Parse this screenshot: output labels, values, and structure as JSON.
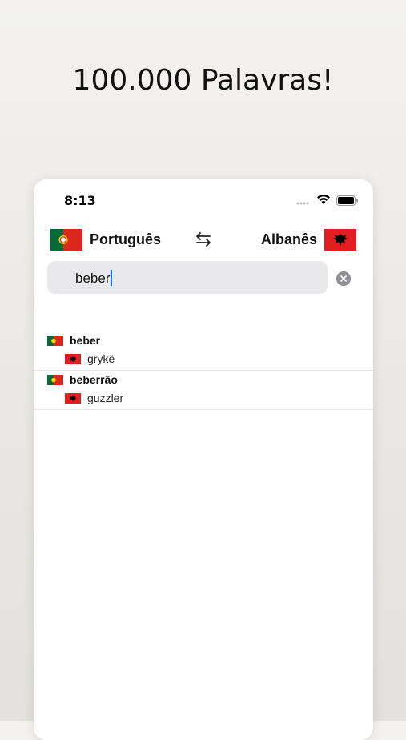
{
  "headline": "100.000 Palavras!",
  "status": {
    "time": "8:13"
  },
  "languages": {
    "source": "Português",
    "target": "Albanês",
    "source_flag": "portugal-flag",
    "target_flag": "albania-flag"
  },
  "search": {
    "value": "beber"
  },
  "results": [
    {
      "word": "beber",
      "translation": "grykë"
    },
    {
      "word": "beberrão",
      "translation": "guzzler"
    }
  ],
  "colors": {
    "portugal_green": "#046a38",
    "portugal_red": "#da291c",
    "albania_red": "#e41e20",
    "caret": "#1a6ef5",
    "search_bg": "#e9e9eb"
  }
}
